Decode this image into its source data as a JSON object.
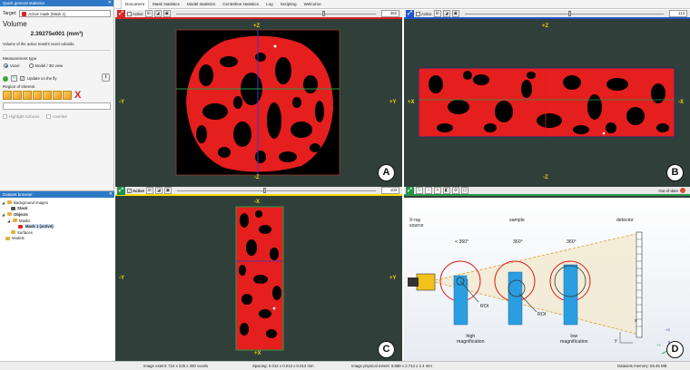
{
  "qs_panel": {
    "title": "Quick general statistics",
    "target_label": "Target:",
    "target_value": "Active mask (Mask 1)",
    "section": "Volume",
    "value": "2.39275e001 (mm³)",
    "description": "Volume of the active mask's voxel cuboids.",
    "measurement_type_label": "Measurement type",
    "option_voxel": "Voxel",
    "option_model": "Model / 3D view",
    "update_label": "Update on the fly",
    "roi_label": "Region of interest",
    "highlight_surfaces": "Highlight surfaces",
    "inverted": "Inverted"
  },
  "dataset_browser": {
    "title": "Dataset browser",
    "items": [
      {
        "label": "Background images",
        "level": 0,
        "icon": "folder"
      },
      {
        "label": "Stack",
        "level": 1,
        "icon": "stack"
      },
      {
        "label": "Objects",
        "level": 0,
        "icon": "folder"
      },
      {
        "label": "Masks",
        "level": 1,
        "icon": "folder"
      },
      {
        "label": "Mask 1 (active)",
        "level": 2,
        "icon": "mask"
      },
      {
        "label": "Surfaces",
        "level": 1,
        "icon": "folder"
      },
      {
        "label": "Models",
        "level": 0,
        "icon": "folder"
      }
    ]
  },
  "menu": [
    "Document",
    "Mask statistics",
    "Model statistics",
    "Centreline statistics",
    "Log",
    "Scripting",
    "Welcome"
  ],
  "viewports": {
    "a": {
      "active_label": "Active",
      "slice": "362",
      "slider_fraction": 0.74,
      "top": "+Z",
      "bottom": "-Z",
      "left": "-Y",
      "right": "+Y",
      "letter": "A"
    },
    "b": {
      "active_label": "Active",
      "slice": "113",
      "slider_fraction": 0.53,
      "top": "+Z",
      "bottom": "-Z",
      "left": "+X",
      "right": "-X",
      "letter": "B"
    },
    "c": {
      "active_label": "Active",
      "slice": "100",
      "slider_fraction": 0.44,
      "top": "-X",
      "bottom": "+X",
      "left": "-Y",
      "right": "+Y",
      "letter": "C"
    },
    "d": {
      "status": "Out-of-date",
      "letter": "D"
    }
  },
  "schematic": {
    "xray_source": "X-ray\nsource",
    "sample": "sample",
    "detector": "detector",
    "angle1": "< 360°",
    "angle2": "360°",
    "angle3": "360°",
    "roi1": "ROI",
    "roi2": "ROI",
    "high_mag": "high\nmagnification",
    "low_mag": "low\nmagnification",
    "axis_x": "x",
    "axis_y": "y",
    "axis_z": "+Z",
    "axis_yy": "+Y",
    "axis_xx": "+X"
  },
  "status_bar": {
    "extent": "Image extent: 724 x 226 x 200 voxels",
    "spacing": "Spacing: 0.012 x 0.012 x 0.012 mm",
    "physical": "Image physical extent: 8.688 x 2.712 x 2.4 mm",
    "memory": "Datasets memory: 65.45 MB"
  },
  "colors": {
    "mask": "#e51e1e",
    "axis_label": "#e6d800",
    "panel_header": "#2e78c6",
    "part": "#2a9ee0"
  }
}
